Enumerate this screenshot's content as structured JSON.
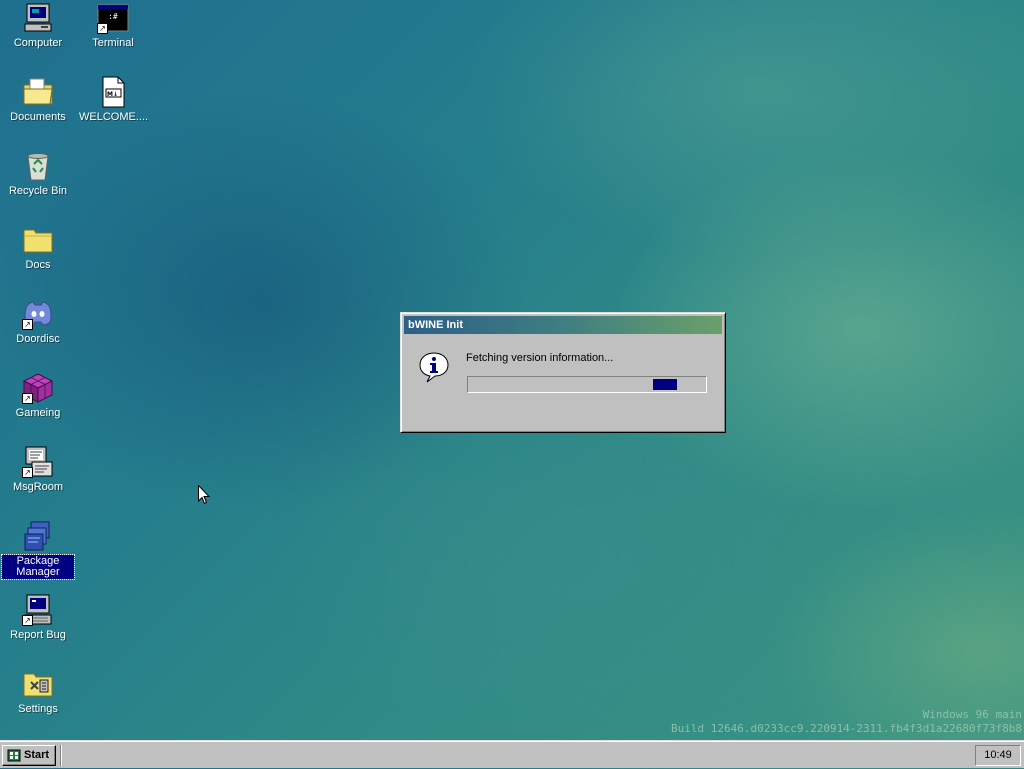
{
  "desktop": {
    "icons": [
      {
        "label": "Computer",
        "icon": "computer-icon",
        "shortcut": false,
        "selected": false
      },
      {
        "label": "Terminal",
        "icon": "terminal-icon",
        "shortcut": true,
        "selected": false
      },
      {
        "label": "Documents",
        "icon": "documents-folder-icon",
        "shortcut": false,
        "selected": false
      },
      {
        "label": "WELCOME....",
        "icon": "markdown-file-icon",
        "shortcut": false,
        "selected": false
      },
      {
        "label": "Recycle Bin",
        "icon": "recycle-bin-icon",
        "shortcut": false,
        "selected": false
      },
      {
        "label": "Docs",
        "icon": "folder-icon",
        "shortcut": false,
        "selected": false
      },
      {
        "label": "Doordisc",
        "icon": "discord-icon",
        "shortcut": true,
        "selected": false
      },
      {
        "label": "Gameing",
        "icon": "game-cube-icon",
        "shortcut": true,
        "selected": false
      },
      {
        "label": "MsgRoom",
        "icon": "msgroom-icon",
        "shortcut": true,
        "selected": false
      },
      {
        "label": "Package Manager",
        "icon": "package-manager-icon",
        "shortcut": false,
        "selected": true
      },
      {
        "label": "Report Bug",
        "icon": "report-bug-icon",
        "shortcut": true,
        "selected": false
      },
      {
        "label": "Settings",
        "icon": "settings-icon",
        "shortcut": false,
        "selected": false
      }
    ],
    "shortcut_glyph": "↗"
  },
  "dialog": {
    "title": "bWINE Init",
    "message": "Fetching version information...",
    "icon": "info-icon",
    "progress_style": "marquee",
    "progress_position": 0.87
  },
  "watermark": {
    "line1": "Windows 96 main",
    "line2": "Build 12646.d0233cc9.220914-2311.fb4f3d1a22680f73f8b8"
  },
  "taskbar": {
    "start_label": "Start",
    "clock": "10:49"
  },
  "colors": {
    "selection": "#000080",
    "title_gradient_start": "#2c5f86",
    "title_gradient_end": "#6aa06a",
    "progress_fill": "#000080",
    "face": "#c0c0c0"
  }
}
